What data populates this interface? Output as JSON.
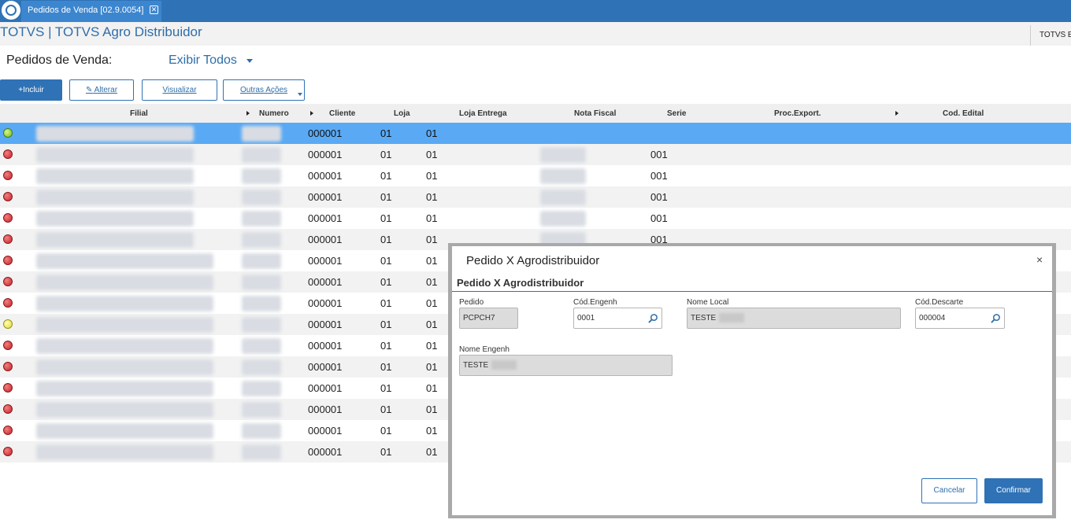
{
  "window": {
    "tab_title": "Pedidos de Venda [02.9.0054]",
    "tab_close": "✕"
  },
  "header": {
    "app_title": "TOTVS | TOTVS Agro Distribuidor",
    "corner_label": "TOTVS E"
  },
  "filter": {
    "label": "Pedidos de Venda:",
    "value": "Exibir Todos"
  },
  "toolbar": {
    "incluir": "+Incluir",
    "alterar": "Alterar",
    "visualizar": "Visualizar",
    "outras": "Outras Ações"
  },
  "grid": {
    "columns": [
      "Filial",
      "Numero",
      "Cliente",
      "Loja",
      "Loja Entrega",
      "Nota Fiscal",
      "Serie",
      "Proc.Export.",
      "Cod. Edital"
    ],
    "rows": [
      {
        "status": "green",
        "cliente": "000001",
        "loja": "01",
        "loja_entrega": "01",
        "serie": ""
      },
      {
        "status": "red",
        "cliente": "000001",
        "loja": "01",
        "loja_entrega": "01",
        "serie": "001"
      },
      {
        "status": "red",
        "cliente": "000001",
        "loja": "01",
        "loja_entrega": "01",
        "serie": "001"
      },
      {
        "status": "red",
        "cliente": "000001",
        "loja": "01",
        "loja_entrega": "01",
        "serie": "001"
      },
      {
        "status": "red",
        "cliente": "000001",
        "loja": "01",
        "loja_entrega": "01",
        "serie": "001"
      },
      {
        "status": "red",
        "cliente": "000001",
        "loja": "01",
        "loja_entrega": "01",
        "serie": "001"
      },
      {
        "status": "red",
        "cliente": "000001",
        "loja": "01",
        "loja_entrega": "01",
        "serie": ""
      },
      {
        "status": "red",
        "cliente": "000001",
        "loja": "01",
        "loja_entrega": "01",
        "serie": ""
      },
      {
        "status": "red",
        "cliente": "000001",
        "loja": "01",
        "loja_entrega": "01",
        "serie": ""
      },
      {
        "status": "yellow",
        "cliente": "000001",
        "loja": "01",
        "loja_entrega": "01",
        "serie": ""
      },
      {
        "status": "red",
        "cliente": "000001",
        "loja": "01",
        "loja_entrega": "01",
        "serie": ""
      },
      {
        "status": "red",
        "cliente": "000001",
        "loja": "01",
        "loja_entrega": "01",
        "serie": ""
      },
      {
        "status": "red",
        "cliente": "000001",
        "loja": "01",
        "loja_entrega": "01",
        "serie": ""
      },
      {
        "status": "red",
        "cliente": "000001",
        "loja": "01",
        "loja_entrega": "01",
        "serie": ""
      },
      {
        "status": "red",
        "cliente": "000001",
        "loja": "01",
        "loja_entrega": "01",
        "serie": ""
      },
      {
        "status": "red",
        "cliente": "000001",
        "loja": "01",
        "loja_entrega": "01",
        "serie": ""
      }
    ]
  },
  "dialog": {
    "title": "Pedido X Agrodistribuidor",
    "close": "×",
    "section": "Pedido X Agrodistribuidor",
    "fields": {
      "pedido": {
        "label": "Pedido",
        "value": "PCPCH7"
      },
      "cod_engenh": {
        "label": "Cód.Engenh",
        "value": "0001"
      },
      "nome_local": {
        "label": "Nome Local",
        "value": "TESTE"
      },
      "cod_descarte": {
        "label": "Cód.Descarte",
        "value": "000004"
      },
      "nome_engenh": {
        "label": "Nome Engenh",
        "value": "TESTE"
      }
    },
    "cancel": "Cancelar",
    "confirm": "Confirmar"
  },
  "colors": {
    "accent": "#2f72b6",
    "selected_row": "#5aa9f4",
    "status_red": "#c8202a",
    "status_green": "#6dbf1a",
    "status_yellow": "#e0d83a"
  }
}
